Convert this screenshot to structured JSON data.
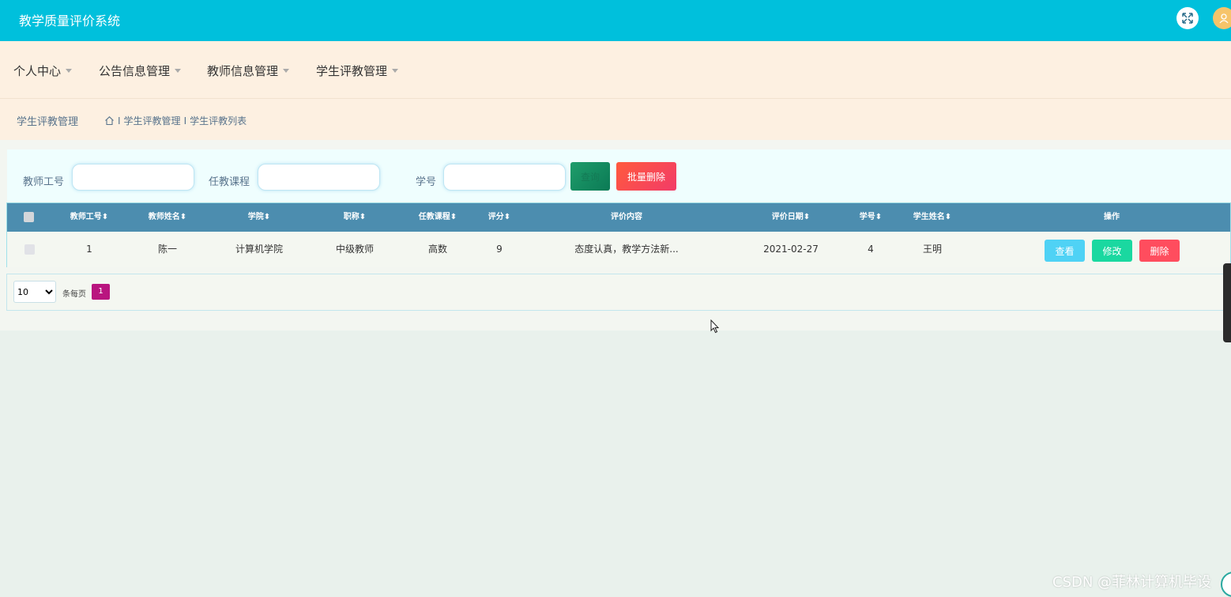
{
  "app": {
    "title": "教学质量评价系统"
  },
  "header_icons": {
    "fullscreen": "fullscreen-icon",
    "avatar": "user-avatar-icon"
  },
  "nav": {
    "items": [
      {
        "label": "个人中心"
      },
      {
        "label": "公告信息管理"
      },
      {
        "label": "教师信息管理"
      },
      {
        "label": "学生评教管理"
      }
    ]
  },
  "breadcrumb": {
    "section_title": "学生评教管理",
    "items": [
      "学生评教管理",
      "学生评教列表"
    ],
    "separator": "I"
  },
  "search": {
    "teacher_id_label": "教师工号",
    "teacher_id_value": "",
    "course_label": "任教课程",
    "course_value": "",
    "student_id_label": "学号",
    "student_id_value": "",
    "search_button": "查询",
    "batch_delete_button": "批量删除"
  },
  "table": {
    "headers": [
      "教师工号",
      "教师姓名",
      "学院",
      "职称",
      "任教课程",
      "评分",
      "评价内容",
      "评价日期",
      "学号",
      "学生姓名",
      "操作"
    ],
    "rows": [
      {
        "cells": [
          "1",
          "陈一",
          "计算机学院",
          "中级教师",
          "高数",
          "9",
          "态度认真，教学方法新...",
          "2021-02-27",
          "4",
          "王明"
        ],
        "actions": {
          "view": "查看",
          "edit": "修改",
          "delete": "删除"
        }
      }
    ]
  },
  "pagination": {
    "page_size": "10",
    "page_size_options": [
      "10"
    ],
    "per_page_label": "条每页",
    "current_page": "1"
  },
  "watermark": "CSDN @菲林计算机毕设",
  "colors": {
    "header_bg": "#00c0dc",
    "nav_bg": "#fdf0e1",
    "table_header_bg": "#4c8daf",
    "view_button": "#4fd2f5",
    "edit_button": "#1ad8a0",
    "delete_button": "#ff4d5e",
    "page_active": "#b9157f"
  }
}
